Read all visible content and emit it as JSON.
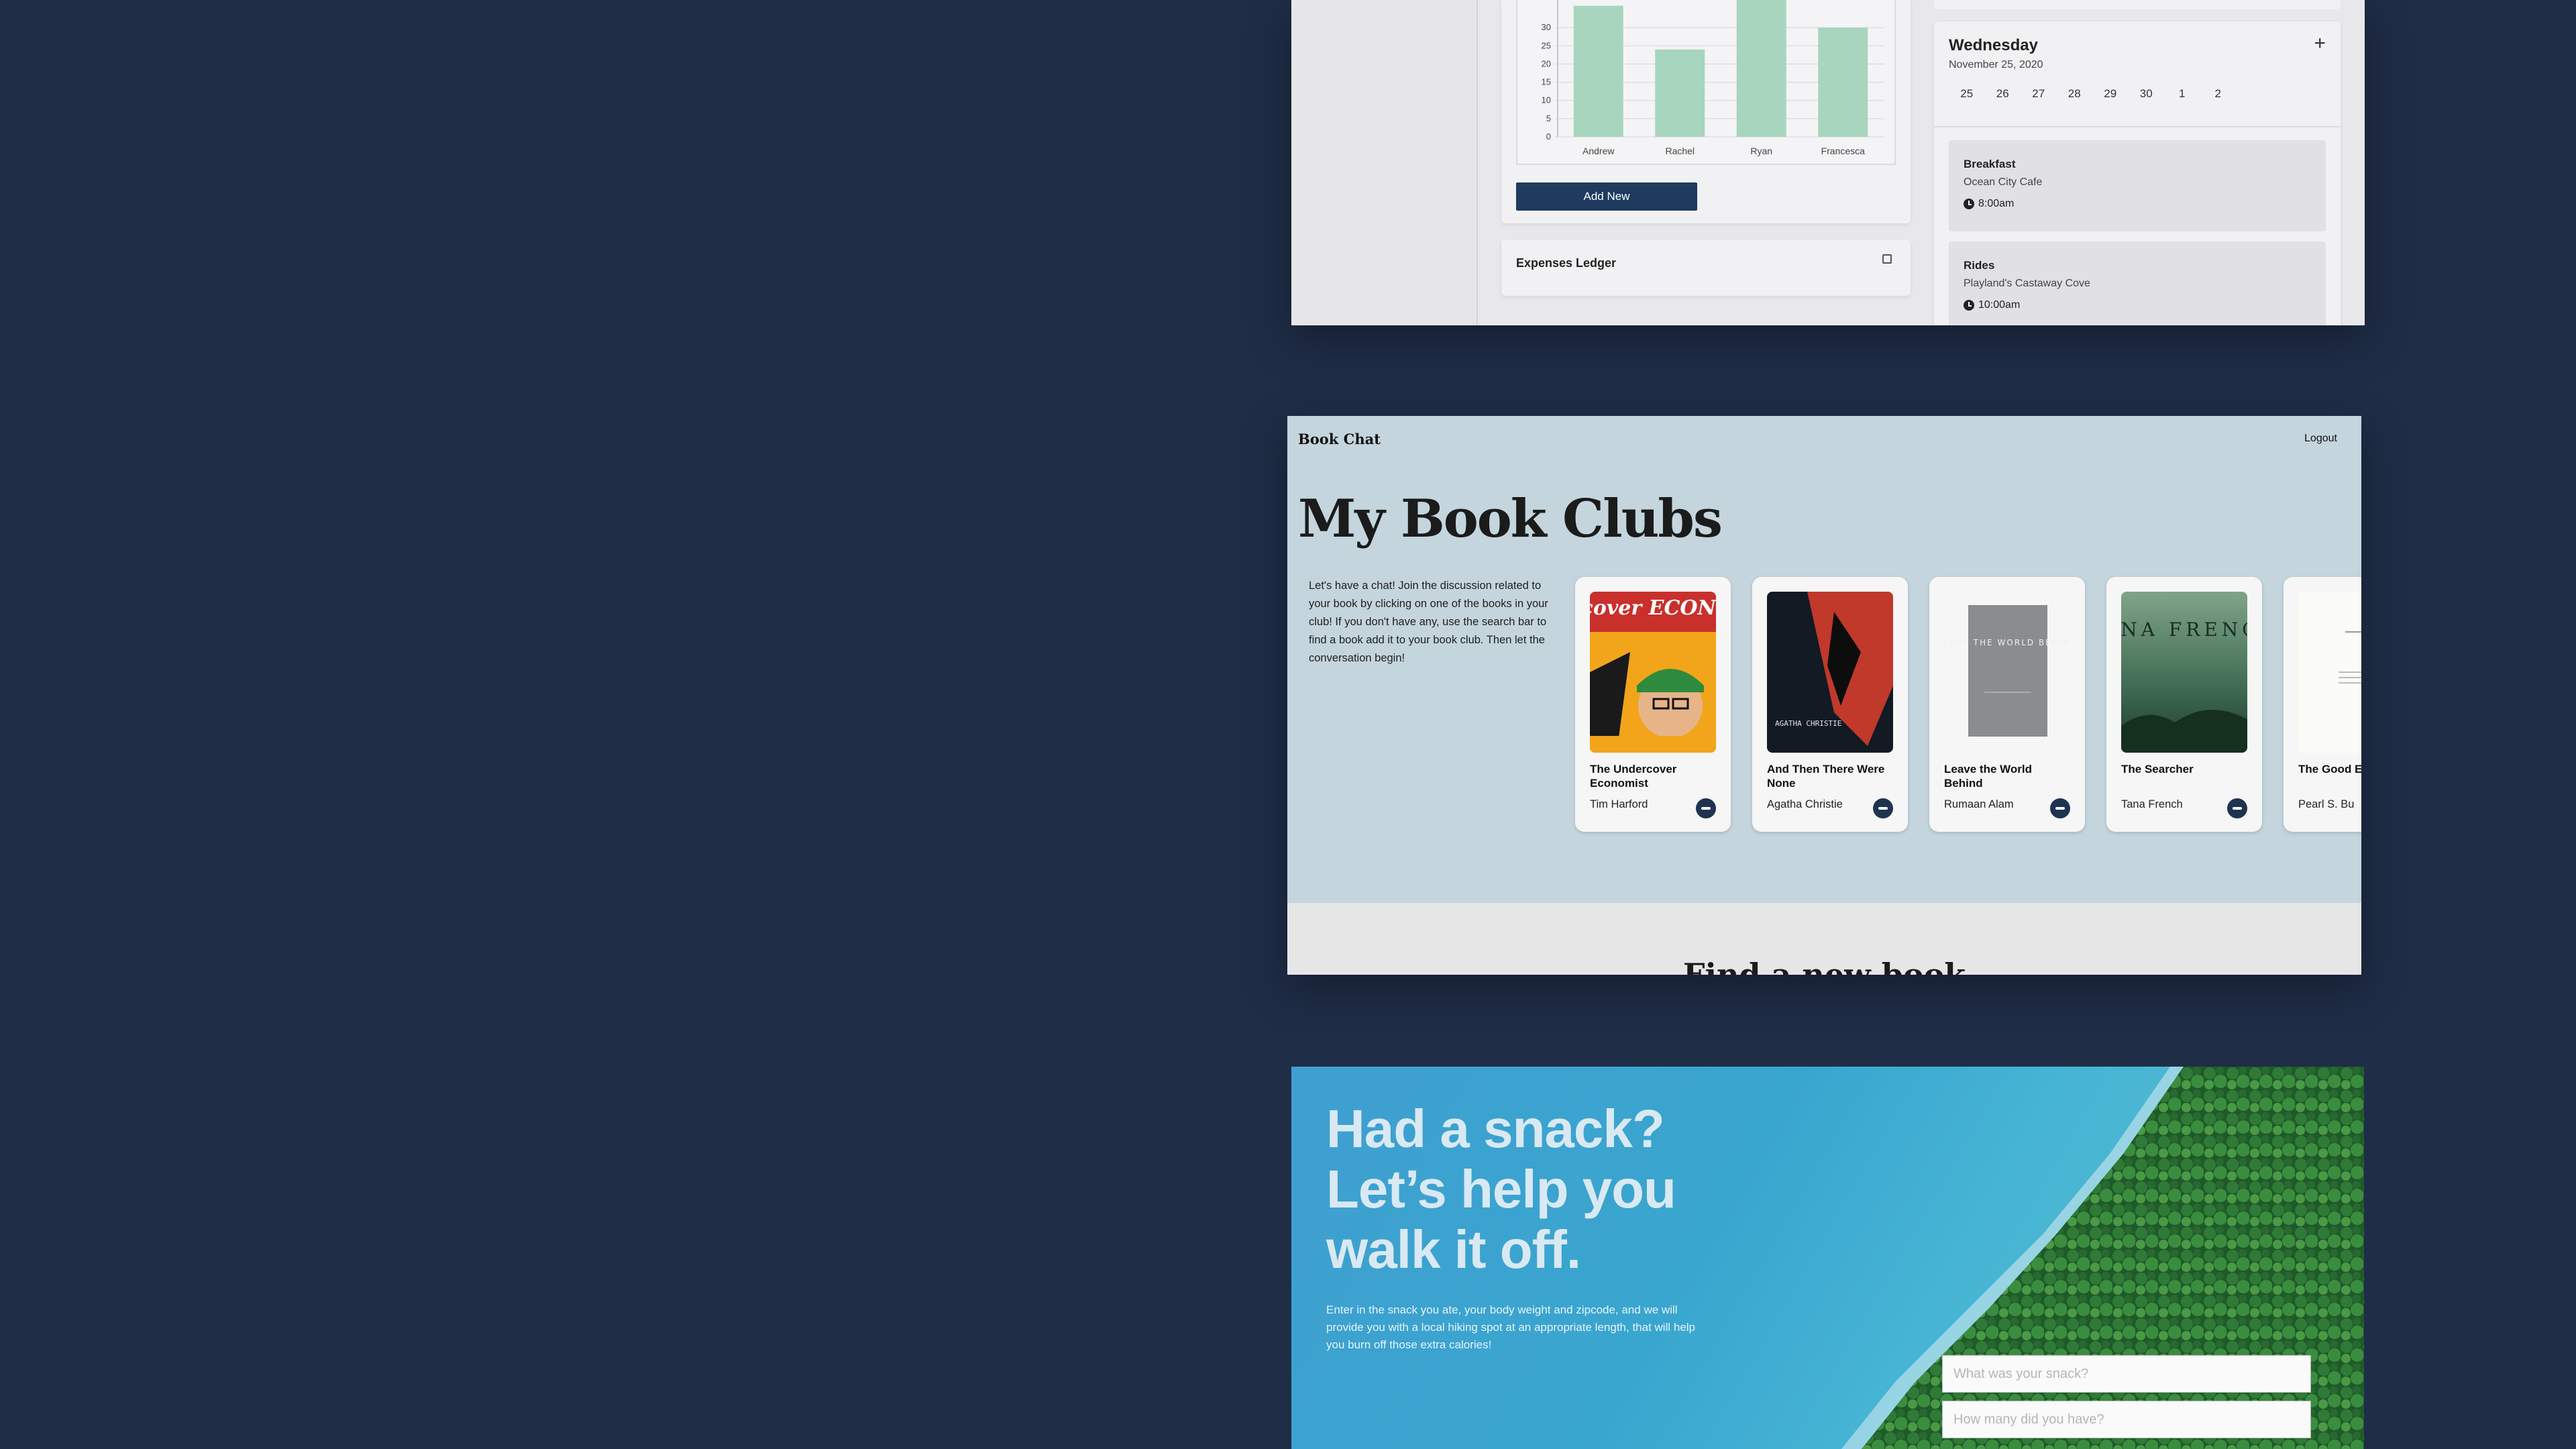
{
  "dashboard": {
    "chart_data": {
      "type": "bar",
      "categories": [
        "Andrew",
        "Rachel",
        "Ryan",
        "Francesca"
      ],
      "values": [
        36,
        24,
        38,
        30
      ],
      "yticks": [
        0,
        5,
        10,
        15,
        20,
        25,
        30
      ],
      "ylim": [
        0,
        35
      ],
      "bar_color": "#a8d5bd"
    },
    "add_button": "Add New",
    "ledger_title": "Expenses Ledger",
    "schedule": {
      "day": "Wednesday",
      "date": "November 25, 2020",
      "dates": [
        "25",
        "26",
        "27",
        "28",
        "29",
        "30",
        "1",
        "2"
      ],
      "events": [
        {
          "name": "Breakfast",
          "location": "Ocean City Cafe",
          "time": "8:00am"
        },
        {
          "name": "Rides",
          "location": "Playland's Castaway Cove",
          "time": "10:00am"
        }
      ]
    }
  },
  "bookchat": {
    "brand": "Book Chat",
    "logout": "Logout",
    "title": "My Book Clubs",
    "intro": "Let's have a chat! Join the discussion related to your book by clicking on one of the books in your club! If you don't have any, use the search bar to find a book add it to your book club. Then let the conversation begin!",
    "books": [
      {
        "title": "The Undercover Economist",
        "author": "Tim Harford",
        "cover_text": "Undercover ECONOMIST"
      },
      {
        "title": "And Then There Were None",
        "author": "Agatha Christie",
        "cover_text": "AGATHA CHRISTIE"
      },
      {
        "title": "Leave the World Behind",
        "author": "Rumaan Alam",
        "cover_text": "LEAVE THE WORLD BEHIND"
      },
      {
        "title": "The Searcher",
        "author": "Tana French",
        "cover_text": "TANA FRENCH"
      },
      {
        "title": "The Good E",
        "author": "Pearl S. Bu",
        "cover_text": ""
      }
    ],
    "find_heading": "Find a new book"
  },
  "snack": {
    "headline_1": "Had a snack?",
    "headline_2": "Let’s help you",
    "headline_3": "walk it off.",
    "description": "Enter in the snack you ate, your body weight and zipcode, and we will provide you with a local hiking spot at an appropriate length, that will help you burn off those extra calories!",
    "snack_placeholder": "What was your snack?",
    "count_placeholder": "How many did you have?"
  }
}
